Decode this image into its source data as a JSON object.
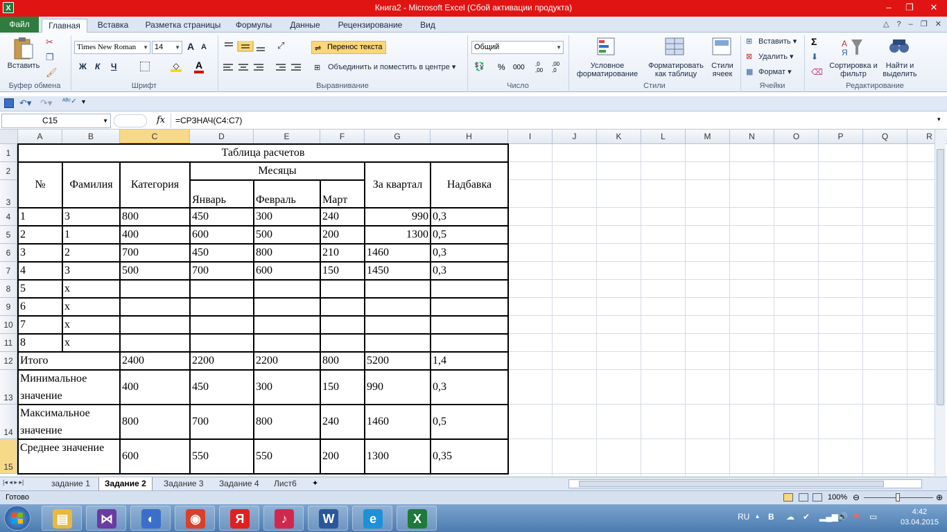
{
  "window": {
    "title": "Книга2  -  Microsoft Excel (Сбой активации продукта)",
    "app_icon": "X",
    "minimize": "–",
    "restore": "❐",
    "close": "✕"
  },
  "ribbon_tabs": [
    {
      "label": "Файл"
    },
    {
      "label": "Главная"
    },
    {
      "label": "Вставка"
    },
    {
      "label": "Разметка страницы"
    },
    {
      "label": "Формулы"
    },
    {
      "label": "Данные"
    },
    {
      "label": "Рецензирование"
    },
    {
      "label": "Вид"
    }
  ],
  "ribbon": {
    "clipboard": {
      "paste_label": "Вставить",
      "group_label": "Буфер обмена"
    },
    "font": {
      "font_name": "Times New Roman",
      "font_size": "14",
      "bold": "Ж",
      "italic": "К",
      "underline": "Ч",
      "group_label": "Шрифт",
      "grow": "A",
      "shrink": "A"
    },
    "alignment": {
      "wrap_text": "Перенос текста",
      "merge_center": "Объединить и поместить в центре",
      "group_label": "Выравнивание"
    },
    "number": {
      "format": "Общий",
      "percent": "%",
      "thousands": "000",
      "inc_dec": ",0 ,00",
      "dec_dec": ",00 ,0",
      "group_label": "Число"
    },
    "styles": {
      "conditional": "Условное форматирование",
      "format_table": "Форматировать как таблицу",
      "cell_styles": "Стили ячеек",
      "group_label": "Стили"
    },
    "cells": {
      "insert": "Вставить",
      "delete": "Удалить",
      "format": "Формат",
      "group_label": "Ячейки"
    },
    "editing": {
      "sum": "Σ",
      "sort": "Сортировка и фильтр",
      "find": "Найти и выделить",
      "group_label": "Редактирование"
    }
  },
  "formula_bar": {
    "name_box": "C15",
    "fx": "fx",
    "formula": "=СРЗНАЧ(C4:C7)"
  },
  "columns": [
    "A",
    "B",
    "C",
    "D",
    "E",
    "F",
    "G",
    "H",
    "I",
    "J",
    "K",
    "L",
    "M",
    "N",
    "O",
    "P",
    "Q",
    "R"
  ],
  "rows": [
    "1",
    "2",
    "3",
    "4",
    "5",
    "6",
    "7",
    "8",
    "9",
    "10",
    "11",
    "12",
    "13",
    "14",
    "15"
  ],
  "table": {
    "title": "Таблица расчетов",
    "h_no": "№",
    "h_surname": "Фамилия",
    "h_category": "Категория",
    "h_months": "Месяцы",
    "h_jan": "Январь",
    "h_feb": "Февраль",
    "h_mar": "Март",
    "h_quarter": "За квартал",
    "h_bonus": "Надбавка",
    "data": [
      [
        "1",
        "3",
        "800",
        "450",
        "300",
        "240",
        "990",
        "0,3"
      ],
      [
        "2",
        "1",
        "400",
        "600",
        "500",
        "200",
        "1300",
        "0,5"
      ],
      [
        "3",
        "2",
        "700",
        "450",
        "800",
        "210",
        "1460",
        "0,3"
      ],
      [
        "4",
        "3",
        "500",
        "700",
        "600",
        "150",
        "1450",
        "0,3"
      ],
      [
        "5",
        "x",
        "",
        "",
        "",
        "",
        "",
        ""
      ],
      [
        "6",
        "x",
        "",
        "",
        "",
        "",
        "",
        ""
      ],
      [
        "7",
        "x",
        "",
        "",
        "",
        "",
        "",
        ""
      ],
      [
        "8",
        "x",
        "",
        "",
        "",
        "",
        "",
        ""
      ]
    ],
    "total": [
      "Итого",
      "2400",
      "2200",
      "2200",
      "800",
      "5200",
      "1,4"
    ],
    "min": [
      "Минимальное значение",
      "400",
      "450",
      "300",
      "150",
      "990",
      "0,3"
    ],
    "max": [
      "Максимальное значение",
      "800",
      "700",
      "800",
      "240",
      "1460",
      "0,5"
    ],
    "avg": [
      "Среднее значение",
      "600",
      "550",
      "550",
      "200",
      "1300",
      "0,35"
    ]
  },
  "sheet_tabs": [
    "задание 1",
    "Задание 2",
    "Задание 3",
    "Задание 4",
    "Лист6"
  ],
  "status": {
    "ready": "Готово",
    "zoom": "100%"
  },
  "taskbar": {
    "lang": "RU",
    "time": "4:42",
    "date": "03.04.2015",
    "apps": [
      {
        "name": "explorer",
        "color": "#e8b840",
        "glyph": "▤"
      },
      {
        "name": "visual-studio",
        "color": "#6a3ca0",
        "glyph": "⋈"
      },
      {
        "name": "media",
        "color": "#3a6ec8",
        "glyph": "◐"
      },
      {
        "name": "chrome",
        "color": "#d8402c",
        "glyph": "◉"
      },
      {
        "name": "yandex",
        "color": "#e02020",
        "glyph": "Я"
      },
      {
        "name": "itunes",
        "color": "#d0284c",
        "glyph": "♪"
      },
      {
        "name": "word",
        "color": "#2b579a",
        "glyph": "W"
      },
      {
        "name": "ie",
        "color": "#1e90d8",
        "glyph": "e"
      },
      {
        "name": "excel",
        "color": "#1d7a3b",
        "glyph": "X"
      }
    ]
  }
}
